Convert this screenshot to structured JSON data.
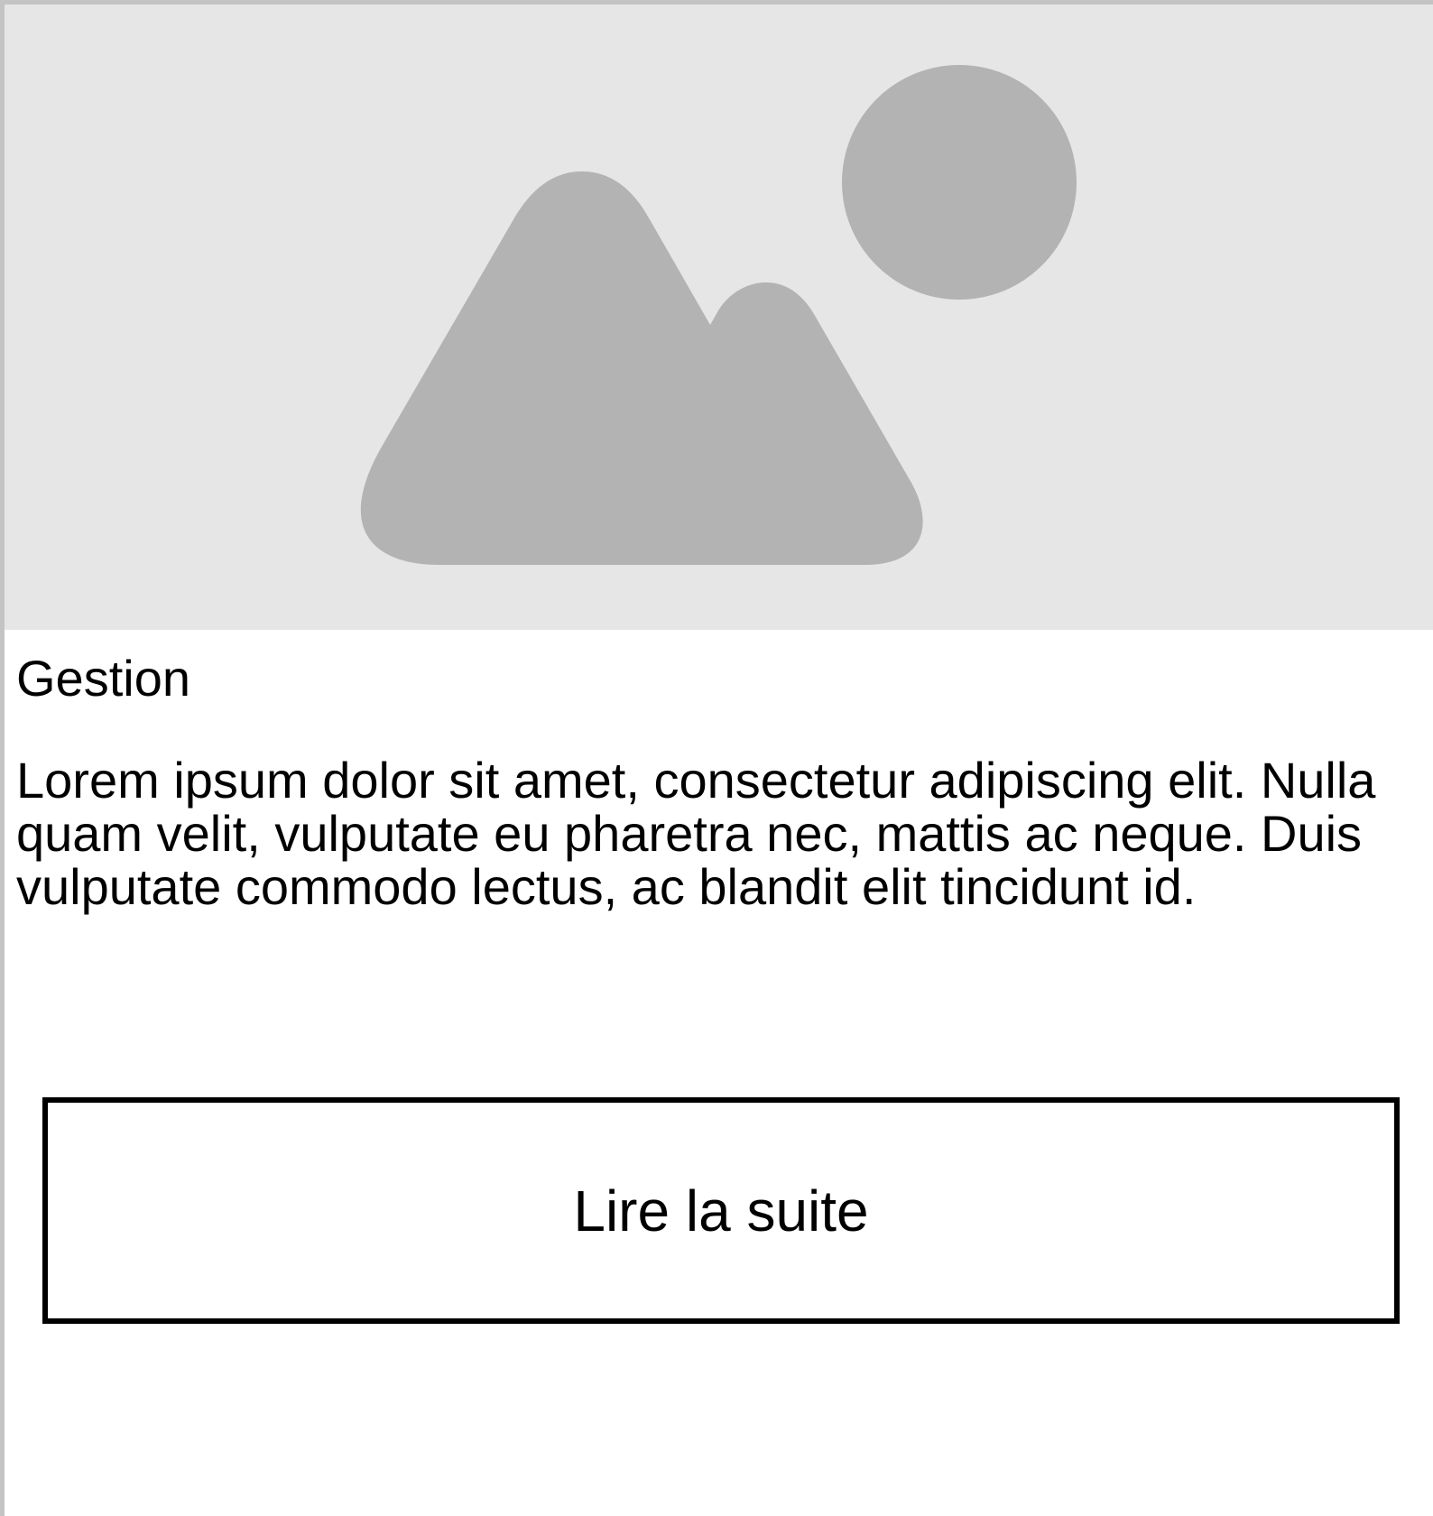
{
  "card": {
    "image": {
      "icon": "image-placeholder-icon",
      "background_color": "#e6e6e6",
      "icon_color": "#b3b3b3"
    },
    "title": "Gestion",
    "text": "Lorem ipsum dolor sit amet, consectetur adipiscing elit. Nulla quam velit, vulputate eu pharetra nec, mattis ac neque. Duis vulputate commodo lectus, ac blandit elit tincidunt id.",
    "button_label": "Lire la suite"
  }
}
